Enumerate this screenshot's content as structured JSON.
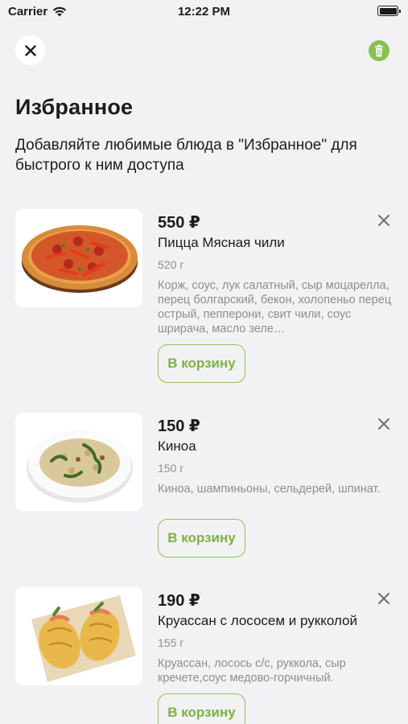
{
  "status_bar": {
    "carrier": "Carrier",
    "time": "12:22 PM"
  },
  "header": {
    "title": "Избранное",
    "subtitle": "Добавляйте любимые блюда в \"Избранное\" для быстрого к ним доступа"
  },
  "accent_color": "#8cc152",
  "items": [
    {
      "price": "550 ₽",
      "name": "Пицца Мясная чили",
      "weight": "520 г",
      "description": "Корж, соус, лук салатный, сыр моцарелла, перец болгарский, бекон, холопеньо перец острый, пепперони, свит чили, соус шрирача, масло зеле…",
      "cart_label": "В корзину"
    },
    {
      "price": "150 ₽",
      "name": "Киноа",
      "weight": "150 г",
      "description": "Киноа, шампиньоны, сельдерей, шпинат.",
      "cart_label": "В корзину"
    },
    {
      "price": "190 ₽",
      "name": "Круассан с лососем и рукколой",
      "weight": "155 г",
      "description": "Круассан, лосось с/с, руккола, сыр кречете,соус медово-горчичный.",
      "cart_label": "В корзину"
    }
  ]
}
